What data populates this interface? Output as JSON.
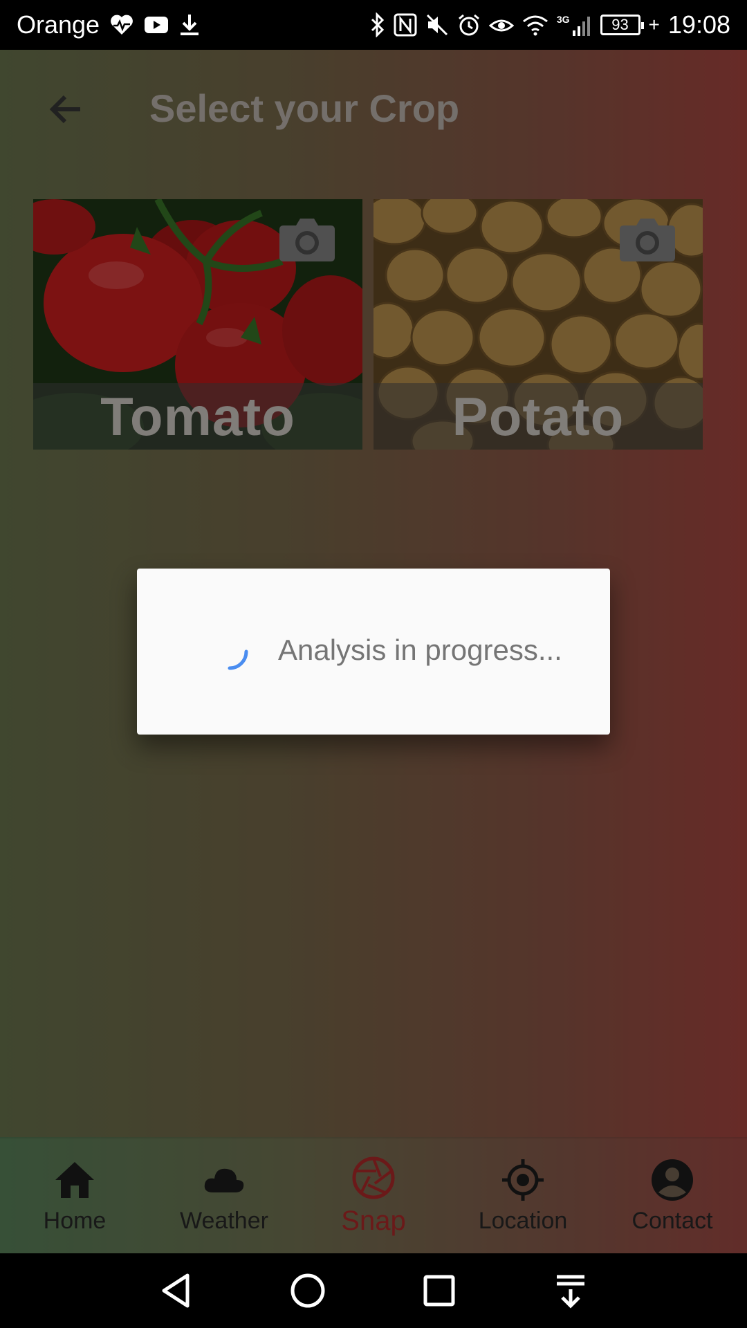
{
  "status_bar": {
    "carrier": "Orange",
    "battery": "93",
    "time": "19:08",
    "network": "3G"
  },
  "app_bar": {
    "title": "Select your Crop"
  },
  "crops": [
    {
      "label": "Tomato"
    },
    {
      "label": "Potato"
    }
  ],
  "dialog": {
    "message": "Analysis in progress..."
  },
  "bottom_nav": {
    "items": [
      {
        "label": "Home",
        "icon": "home-icon"
      },
      {
        "label": "Weather",
        "icon": "cloud-icon"
      },
      {
        "label": "Snap",
        "icon": "camera-shutter-icon",
        "active": true
      },
      {
        "label": "Location",
        "icon": "location-target-icon"
      },
      {
        "label": "Contact",
        "icon": "account-circle-icon"
      }
    ]
  },
  "colors": {
    "active": "#b82c2c",
    "spinner": "#4a8df0"
  }
}
